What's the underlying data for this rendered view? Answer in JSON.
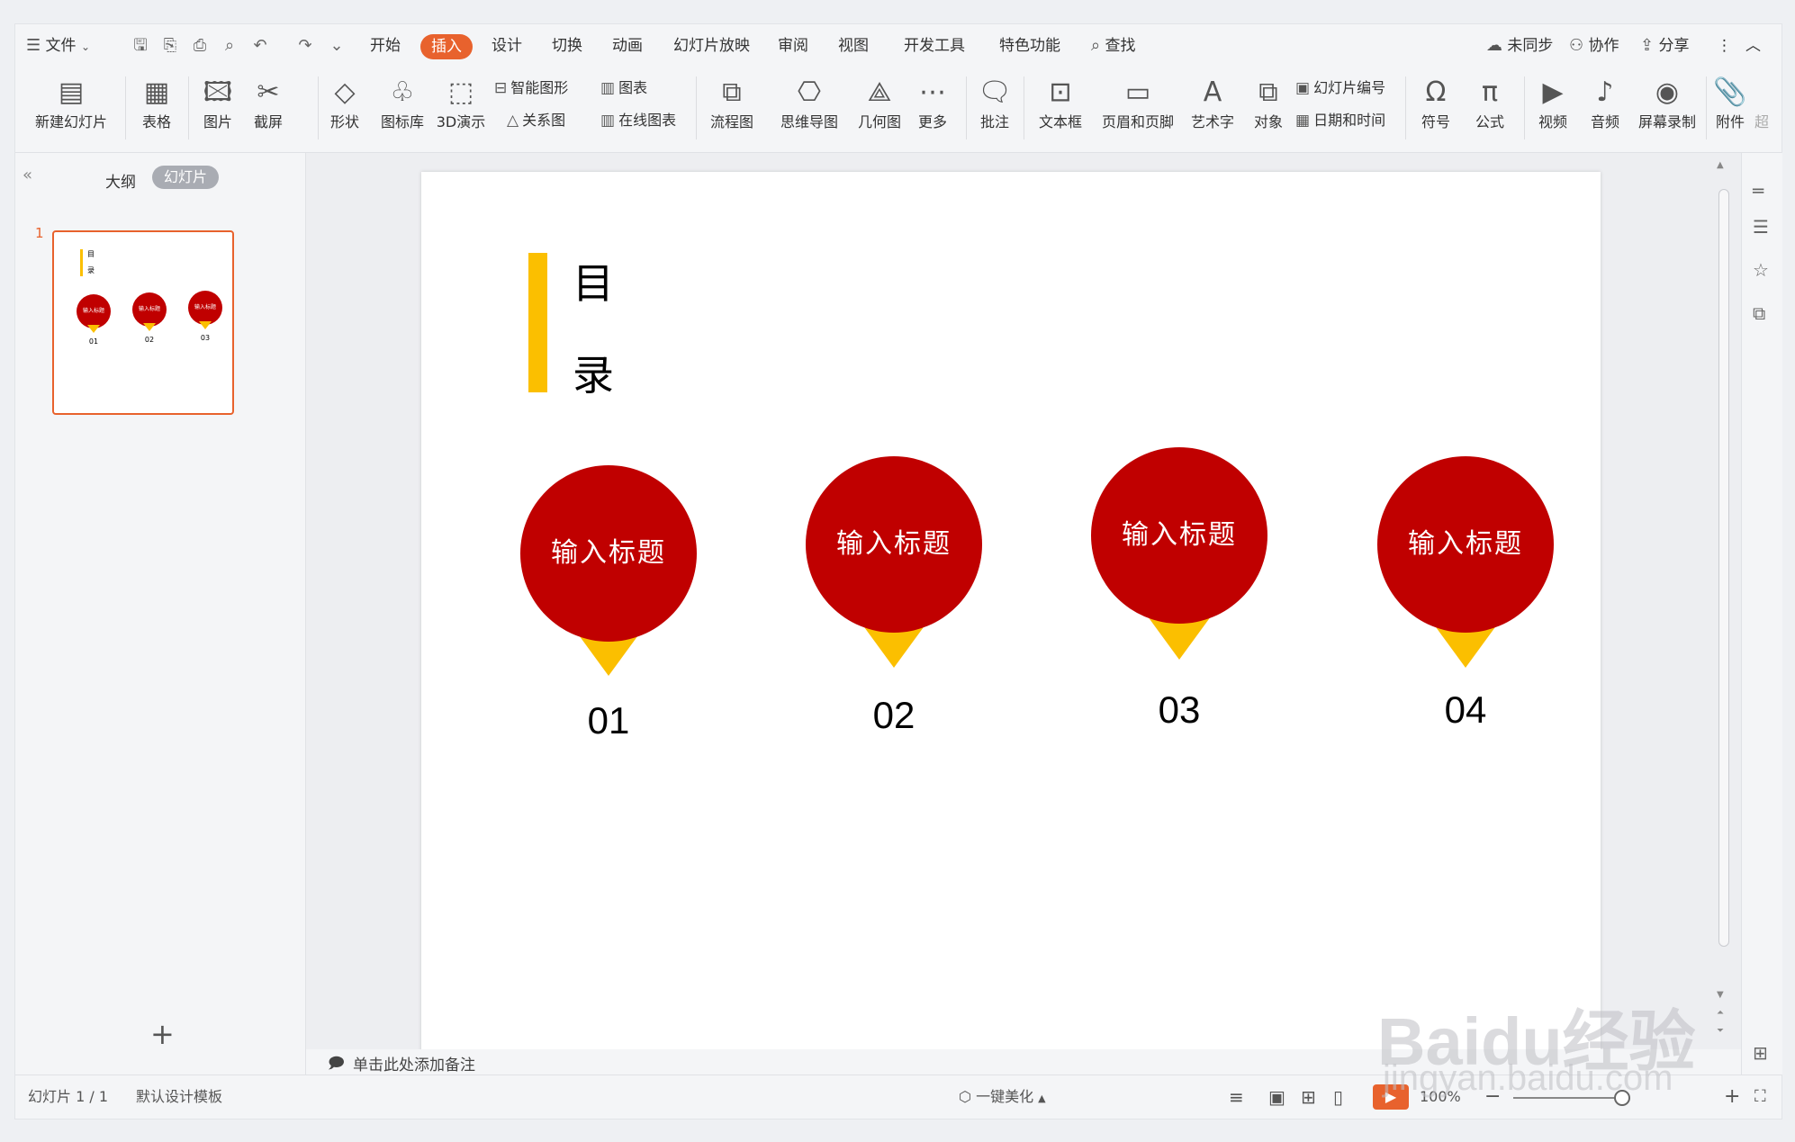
{
  "menu": {
    "file": "文件",
    "tabs": [
      "开始",
      "插入",
      "设计",
      "切换",
      "动画",
      "幻灯片放映",
      "审阅",
      "视图",
      "开发工具",
      "特色功能"
    ],
    "active_tab": "插入",
    "search": "查找",
    "sync": "未同步",
    "collab": "协作",
    "share": "分享"
  },
  "ribbon": {
    "new_slide": "新建幻灯片",
    "table": "表格",
    "picture": "图片",
    "screenshot": "截屏",
    "shape": "形状",
    "icon_lib": "图标库",
    "demo3d": "3D演示",
    "smart_art": "智能图形",
    "chart": "图表",
    "relation": "关系图",
    "online_chart": "在线图表",
    "flowchart": "流程图",
    "mindmap": "思维导图",
    "geometry": "几何图",
    "more": "更多",
    "comment": "批注",
    "textbox": "文本框",
    "header_footer": "页眉和页脚",
    "wordart": "艺术字",
    "object": "对象",
    "slide_number": "幻灯片编号",
    "datetime": "日期和时间",
    "symbol": "符号",
    "formula": "公式",
    "video": "视频",
    "audio": "音频",
    "screen_record": "屏幕录制",
    "attachment": "附件",
    "hyperlink_partial": "超"
  },
  "left_panel": {
    "outline": "大纲",
    "slides": "幻灯片",
    "slide_index": "1"
  },
  "slide": {
    "toc_char1": "目",
    "toc_char2": "录",
    "items": [
      {
        "title": "输入标题",
        "number": "01"
      },
      {
        "title": "输入标题",
        "number": "02"
      },
      {
        "title": "输入标题",
        "number": "03"
      },
      {
        "title": "输入标题",
        "number": "04"
      }
    ],
    "colors": {
      "circle": "#c00000",
      "accent": "#fbbf00"
    }
  },
  "notes": {
    "placeholder": "单击此处添加备注"
  },
  "status": {
    "slide_info": "幻灯片 1 / 1",
    "template": "默认设计模板",
    "beautify": "一键美化",
    "zoom": "100%"
  },
  "watermark": {
    "brand": "Baidu经验",
    "url": "jingyan.baidu.com"
  }
}
